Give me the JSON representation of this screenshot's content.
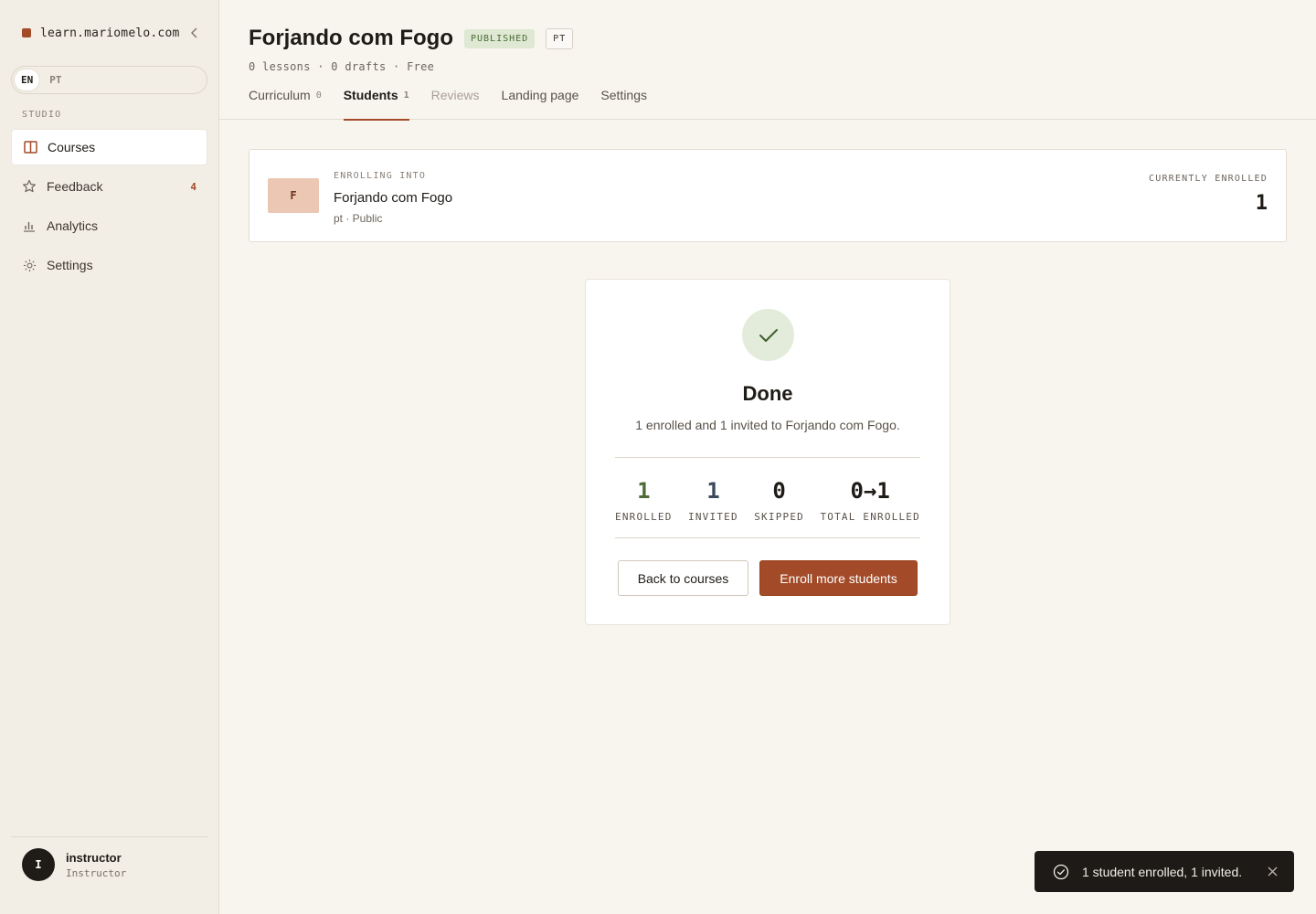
{
  "sidebar": {
    "site_name": "learn.mariomelo.com",
    "language_options": [
      "EN",
      "PT"
    ],
    "section_label": "STUDIO",
    "items": [
      {
        "label": "Courses",
        "icon": "book-icon",
        "active": true
      },
      {
        "label": "Feedback",
        "icon": "star-icon",
        "badge": "4"
      },
      {
        "label": "Analytics",
        "icon": "bar-chart-icon"
      },
      {
        "label": "Settings",
        "icon": "gear-icon"
      }
    ],
    "user": {
      "initial": "I",
      "name": "instructor",
      "role": "Instructor"
    }
  },
  "header": {
    "title": "Forjando com Fogo",
    "status_badge": "PUBLISHED",
    "language_badge": "PT",
    "meta": "0 lessons · 0 drafts · Free",
    "tabs": [
      {
        "label": "Curriculum",
        "count": "0"
      },
      {
        "label": "Students",
        "count": "1",
        "active": true
      },
      {
        "label": "Reviews",
        "disabled": true
      },
      {
        "label": "Landing page"
      },
      {
        "label": "Settings"
      }
    ]
  },
  "enrollment": {
    "thumb_letter": "F",
    "label": "ENROLLING INTO",
    "course_name": "Forjando com Fogo",
    "subtitle": "pt · Public",
    "current_label": "CURRENTLY ENROLLED",
    "current_value": "1"
  },
  "result": {
    "title": "Done",
    "description": "1 enrolled and 1 invited to Forjando com Fogo.",
    "stats": [
      {
        "value": "1",
        "label": "ENROLLED"
      },
      {
        "value": "1",
        "label": "INVITED"
      },
      {
        "value": "0",
        "label": "SKIPPED"
      },
      {
        "value": "0→1",
        "label": "TOTAL ENROLLED"
      }
    ],
    "back_button": "Back to courses",
    "enroll_button": "Enroll more students"
  },
  "toast": {
    "message": "1 student enrolled, 1 invited."
  },
  "colors": {
    "accent": "#a34a28",
    "success": "#4d6d38",
    "background": "#f8f5ef",
    "sidebar": "#f2ede5"
  }
}
